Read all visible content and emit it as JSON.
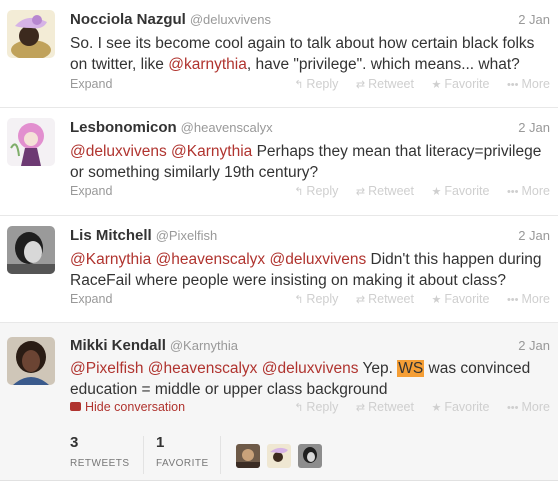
{
  "tweets": [
    {
      "name": "Nocciola Nazgul",
      "handle": "@deluxvivens",
      "time": "2 Jan",
      "text_1": "So. I see its become cool again to talk about how certain black folks on twitter, like ",
      "mention_1": "@karnythia",
      "text_2": ", have \"privilege\". which means... what?",
      "expand_label": "Expand"
    },
    {
      "name": "Lesbonomicon",
      "handle": "@heavenscalyx",
      "time": "2 Jan",
      "mention_1": "@deluxvivens",
      "mention_2": "@Karnythia",
      "text_1": " Perhaps they mean that literacy=privilege or something similarly 19th century?",
      "expand_label": "Expand"
    },
    {
      "name": "Lis Mitchell",
      "handle": "@Pixelfish",
      "time": "2 Jan",
      "mention_1": "@Karnythia",
      "mention_2": "@heavenscalyx",
      "mention_3": "@deluxvivens",
      "text_1": " Didn't this happen during RaceFail where people were insisting on making it about class?",
      "expand_label": "Expand"
    },
    {
      "name": "Mikki Kendall",
      "handle": "@Karnythia",
      "time": "2 Jan",
      "mention_1": "@Pixelfish",
      "mention_2": "@heavenscalyx",
      "mention_3": "@deluxvivens",
      "text_1": " Yep. ",
      "highlight": "WS",
      "text_2": " was convinced education = middle or upper class background",
      "hide_label": "Hide conversation",
      "retweets": "3",
      "retweets_label": "RETWEETS",
      "favorites": "1",
      "favorites_label": "FAVORITE"
    }
  ],
  "actions": {
    "reply": "Reply",
    "retweet": "Retweet",
    "favorite": "Favorite",
    "more": "More"
  },
  "icons": {
    "reply": "reply-arrow-icon",
    "retweet": "retweet-icon",
    "favorite": "star-icon",
    "more": "ellipsis-icon",
    "hide": "conversation-bubble-icon"
  },
  "colors": {
    "mention": "#b0342f",
    "highlight": "#f59e35",
    "muted": "#999999",
    "action": "#cfcfcf"
  }
}
